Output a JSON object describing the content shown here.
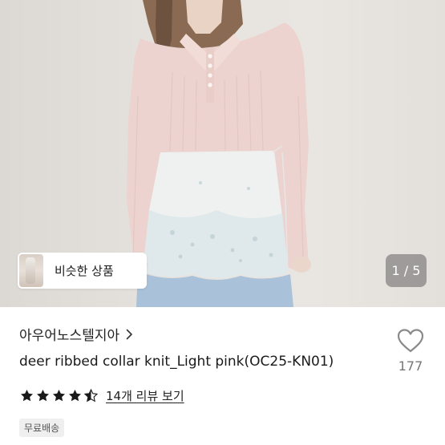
{
  "gallery": {
    "similar_label": "비슷한 상품",
    "page_counter": "1 / 5"
  },
  "product": {
    "shop_name": "아우어노스텔지아",
    "title": "deer ribbed collar knit_Light pink(OC25-KN01)",
    "like_count": "177",
    "rating": 4.5,
    "review_link": "14개 리뷰 보기",
    "shipping_badge": "무료배송"
  },
  "icons": {
    "shop_chevron": "chevron-right-icon",
    "like": "heart-outline-icon",
    "star": "star-icon"
  },
  "colors": {
    "star": "#1a1a1a",
    "heart_stroke": "#8a8a8a"
  }
}
